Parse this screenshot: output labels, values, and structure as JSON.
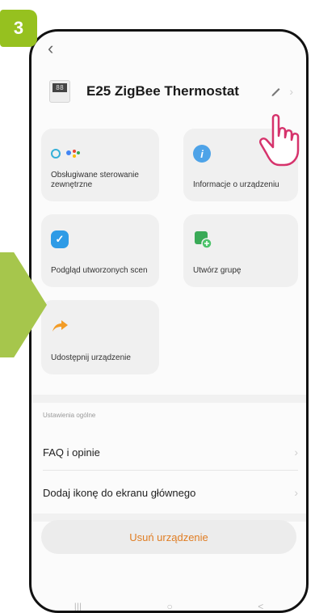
{
  "step": {
    "number": "3"
  },
  "colors": {
    "accent": "#96c11f",
    "remove": "#e07d23",
    "hand": "#d6336c"
  },
  "header": {
    "back_icon": "chevron-left-icon",
    "device_thumb_text": "88",
    "device_title": "E25 ZigBee Thermostat",
    "edit_icon": "pencil-icon",
    "chevron_icon": "chevron-right-icon"
  },
  "cards": [
    {
      "name": "card-external-control",
      "label": "Obsługiwane sterowanie zewnętrzne",
      "icons": [
        "alexa-icon",
        "google-assistant-icon"
      ]
    },
    {
      "name": "card-device-info",
      "label": "Informacje o urządzeniu",
      "icons": [
        "info-icon"
      ]
    },
    {
      "name": "card-created-scenes",
      "label": "Podgląd utworzonych scen",
      "icons": [
        "check-icon"
      ]
    },
    {
      "name": "card-create-group",
      "label": "Utwórz grupę",
      "icons": [
        "group-add-icon"
      ]
    },
    {
      "name": "card-share-device",
      "label": "Udostępnij urządzenie",
      "icons": [
        "share-icon"
      ]
    }
  ],
  "general": {
    "caption": "Ustawienia ogólne",
    "items": [
      {
        "label": "FAQ i opinie"
      },
      {
        "label": "Dodaj ikonę do ekranu głównego"
      }
    ]
  },
  "remove_label": "Usuń urządzenie",
  "navbar": {
    "icons": [
      "recent-apps-icon",
      "home-icon",
      "back-icon"
    ],
    "glyphs": [
      "|||",
      "○",
      "<"
    ]
  }
}
